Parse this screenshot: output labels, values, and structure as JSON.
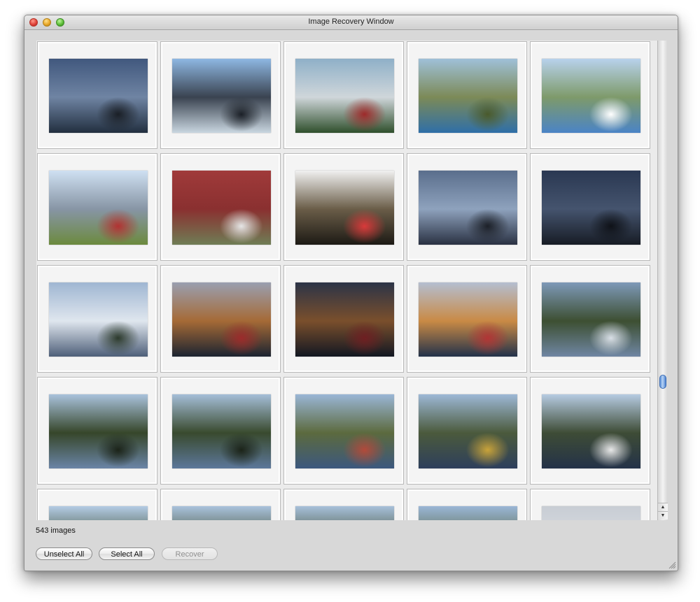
{
  "window": {
    "title": "Image Recovery Window"
  },
  "status": {
    "image_count": "543 images"
  },
  "buttons": {
    "unselect_all": "Unselect All",
    "select_all": "Select All",
    "recover": "Recover"
  },
  "thumbnails": [
    {
      "name": "cloudy-fjord-sky",
      "top": "#41587e",
      "mid": "#6f84a3",
      "bot": "#222f3f",
      "accent": "#1a1f26"
    },
    {
      "name": "jagged-mountains",
      "top": "#8eb7e2",
      "mid": "#3a4350",
      "bot": "#c9d6e0",
      "accent": "#1b2027"
    },
    {
      "name": "village-houses",
      "top": "#8fb0c8",
      "mid": "#cfd6da",
      "bot": "#2f4f2c",
      "accent": "#9e2a2a"
    },
    {
      "name": "coastal-cliff",
      "top": "#9fc0d8",
      "mid": "#7c8a57",
      "bot": "#2f6fa8",
      "accent": "#4a5a2c"
    },
    {
      "name": "valley-village",
      "top": "#b8d2ec",
      "mid": "#7e9a6a",
      "bot": "#4b84c6",
      "accent": "#ffffff"
    },
    {
      "name": "mountain-red-barn",
      "top": "#cfe0f2",
      "mid": "#8795a5",
      "bot": "#6c8a3e",
      "accent": "#b23232"
    },
    {
      "name": "red-wooden-wall",
      "top": "#a03a3a",
      "mid": "#8a3030",
      "bot": "#6f7d55",
      "accent": "#e6e6e6"
    },
    {
      "name": "harbor-boat",
      "top": "#f0f0f0",
      "mid": "#6a5d48",
      "bot": "#1d1a15",
      "accent": "#d93a3a"
    },
    {
      "name": "bridge-dusk",
      "top": "#5a6e8c",
      "mid": "#8ea2bd",
      "bot": "#2a3142",
      "accent": "#1c2028"
    },
    {
      "name": "bridge-dark",
      "top": "#2a3852",
      "mid": "#45546e",
      "bot": "#171c25",
      "accent": "#0f1218"
    },
    {
      "name": "bridge-day",
      "top": "#9fb6d2",
      "mid": "#dfe6ee",
      "bot": "#4e5f79",
      "accent": "#2c3a2c"
    },
    {
      "name": "wharf-houses",
      "top": "#9a9fb0",
      "mid": "#a56a36",
      "bot": "#1c2431",
      "accent": "#9c2b2b"
    },
    {
      "name": "wharf-houses-dark",
      "top": "#2c3447",
      "mid": "#7a4f2c",
      "bot": "#121722",
      "accent": "#6f1f22"
    },
    {
      "name": "wharf-houses-bright",
      "top": "#b4bed0",
      "mid": "#c98a45",
      "bot": "#23324a",
      "accent": "#b23535"
    },
    {
      "name": "rotated-lake-a",
      "top": "#7e99b8",
      "mid": "#3d4f32",
      "bot": "#6f86a3",
      "accent": "#d9dfe6"
    },
    {
      "name": "rotated-lake-b",
      "top": "#a9c2dc",
      "mid": "#36462a",
      "bot": "#6a84a6",
      "accent": "#1b2318"
    },
    {
      "name": "rotated-lake-c",
      "top": "#a5bed8",
      "mid": "#394a2e",
      "bot": "#5c779a",
      "accent": "#1b2318"
    },
    {
      "name": "rotated-lake-d",
      "top": "#9ab6d6",
      "mid": "#5c6a3e",
      "bot": "#3c587e",
      "accent": "#b24a3a"
    },
    {
      "name": "rotated-lake-e",
      "top": "#9db8d6",
      "mid": "#4b5a3c",
      "bot": "#2e3f5c",
      "accent": "#c9a33a"
    },
    {
      "name": "rotated-lake-f",
      "top": "#b6cbe2",
      "mid": "#3e4c36",
      "bot": "#243248",
      "accent": "#e8e8e8"
    },
    {
      "name": "partial-a",
      "top": "#b3cbe4",
      "mid": "#3a4a30",
      "bot": "#7d94b0",
      "accent": "#1b2318"
    },
    {
      "name": "partial-b",
      "top": "#a9c2dc",
      "mid": "#3e4a2e",
      "bot": "#6a84a6",
      "accent": "#1b2318"
    },
    {
      "name": "partial-c",
      "top": "#a7c0da",
      "mid": "#3d4a30",
      "bot": "#5f7b9c",
      "accent": "#1b2318"
    },
    {
      "name": "partial-d",
      "top": "#9ab6d6",
      "mid": "#556440",
      "bot": "#3c587e",
      "accent": "#1b2318"
    },
    {
      "name": "partial-e",
      "top": "#c8cdd4",
      "mid": "#d9dde2",
      "bot": "#b7bcc3",
      "accent": "#9aa1aa"
    }
  ]
}
